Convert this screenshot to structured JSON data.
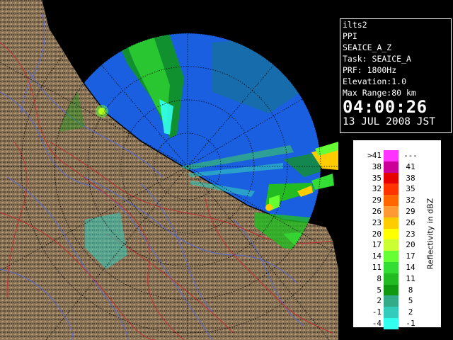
{
  "info": {
    "station": "ilts2",
    "product": "PPI",
    "product_code": "SEAICE_A_Z",
    "task": "Task: SEAICE_A",
    "prf": "PRF: 1800Hz",
    "elevation": "Elevation:1.0",
    "max_range": "Max Range:80 km",
    "time": "04:00:26",
    "date": "13 JUL 2008 JST"
  },
  "legend": {
    "title": "Reflectivity in dBZ",
    "rows": [
      {
        "low": ">41",
        "high": "---",
        "color": "#ff33ff"
      },
      {
        "low": "38",
        "high": "41",
        "color": "#cc0099"
      },
      {
        "low": "35",
        "high": "38",
        "color": "#e60000"
      },
      {
        "low": "32",
        "high": "35",
        "color": "#ff3300"
      },
      {
        "low": "29",
        "high": "32",
        "color": "#ff6600"
      },
      {
        "low": "26",
        "high": "29",
        "color": "#ff9933"
      },
      {
        "low": "23",
        "high": "26",
        "color": "#ffcc00"
      },
      {
        "low": "20",
        "high": "23",
        "color": "#ffff00"
      },
      {
        "low": "17",
        "high": "20",
        "color": "#ccff33"
      },
      {
        "low": "14",
        "high": "17",
        "color": "#66ff33"
      },
      {
        "low": "11",
        "high": "14",
        "color": "#33dd33"
      },
      {
        "low": "8",
        "high": "11",
        "color": "#22bb22"
      },
      {
        "low": "5",
        "high": "8",
        "color": "#119911"
      },
      {
        "low": "2",
        "high": "5",
        "color": "#33aa88"
      },
      {
        "low": "-1",
        "high": "2",
        "color": "#33ccbb"
      },
      {
        "low": "-4",
        "high": "-1",
        "color": "#33ffee"
      }
    ]
  },
  "colors": {
    "radar_range": "#1a5fe0",
    "land": "#8a7355",
    "rivers": "#5a6ad0",
    "boundaries": "#c03030"
  }
}
